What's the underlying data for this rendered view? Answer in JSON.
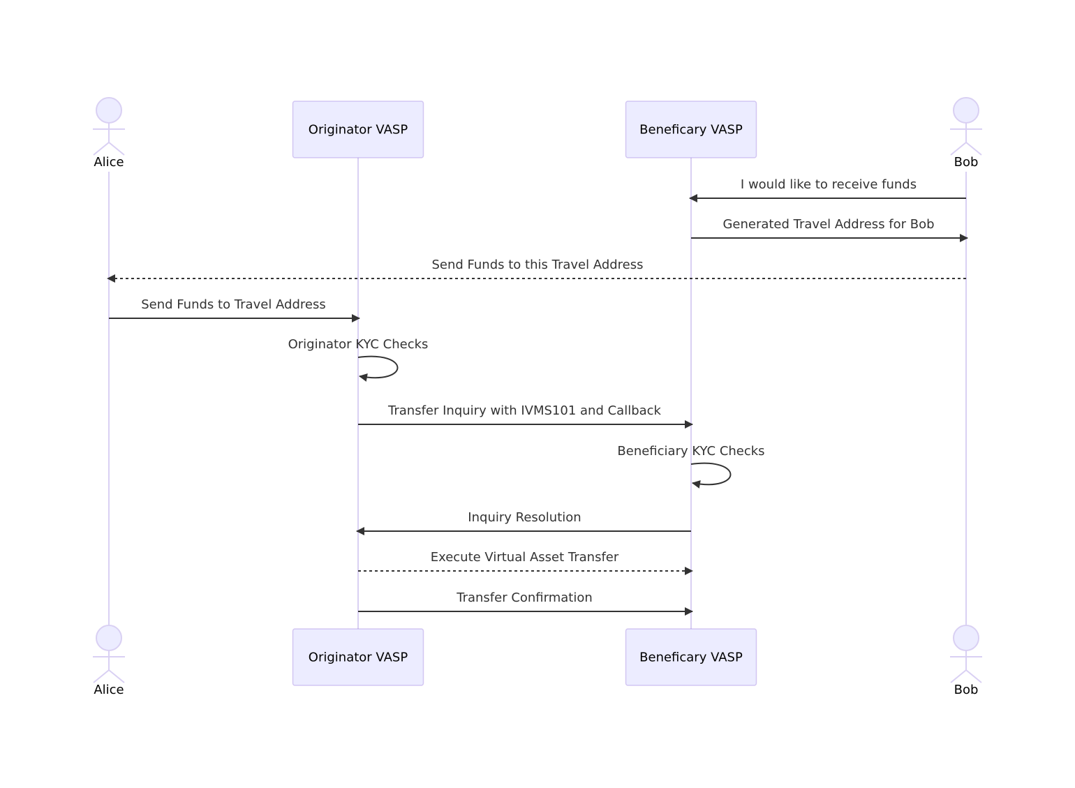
{
  "diagram": {
    "type": "sequence",
    "participants": [
      {
        "id": "alice",
        "label": "Alice",
        "kind": "actor"
      },
      {
        "id": "orig",
        "label": "Originator VASP",
        "kind": "participant"
      },
      {
        "id": "bene",
        "label": "Beneficary VASP",
        "kind": "participant"
      },
      {
        "id": "bob",
        "label": "Bob",
        "kind": "actor"
      }
    ],
    "messages": [
      {
        "from": "bob",
        "to": "bene",
        "label": "I would like to receive funds",
        "style": "solid"
      },
      {
        "from": "bene",
        "to": "bob",
        "label": "Generated Travel Address for Bob",
        "style": "solid"
      },
      {
        "from": "bob",
        "to": "alice",
        "label": "Send Funds to this Travel Address",
        "style": "dashed"
      },
      {
        "from": "alice",
        "to": "orig",
        "label": "Send Funds to Travel Address",
        "style": "solid"
      },
      {
        "from": "orig",
        "to": "orig",
        "label": "Originator KYC Checks",
        "style": "solid"
      },
      {
        "from": "orig",
        "to": "bene",
        "label": "Transfer Inquiry with IVMS101 and Callback",
        "style": "solid"
      },
      {
        "from": "bene",
        "to": "bene",
        "label": "Beneficiary KYC Checks",
        "style": "solid"
      },
      {
        "from": "bene",
        "to": "orig",
        "label": "Inquiry Resolution",
        "style": "solid"
      },
      {
        "from": "orig",
        "to": "bene",
        "label": "Execute Virtual Asset Transfer",
        "style": "dashed"
      },
      {
        "from": "orig",
        "to": "bene",
        "label": "Transfer Confirmation",
        "style": "solid"
      }
    ]
  },
  "colors": {
    "box_fill": "#ECECFF",
    "lifeline": "#D9D0F3",
    "message": "#333333"
  }
}
